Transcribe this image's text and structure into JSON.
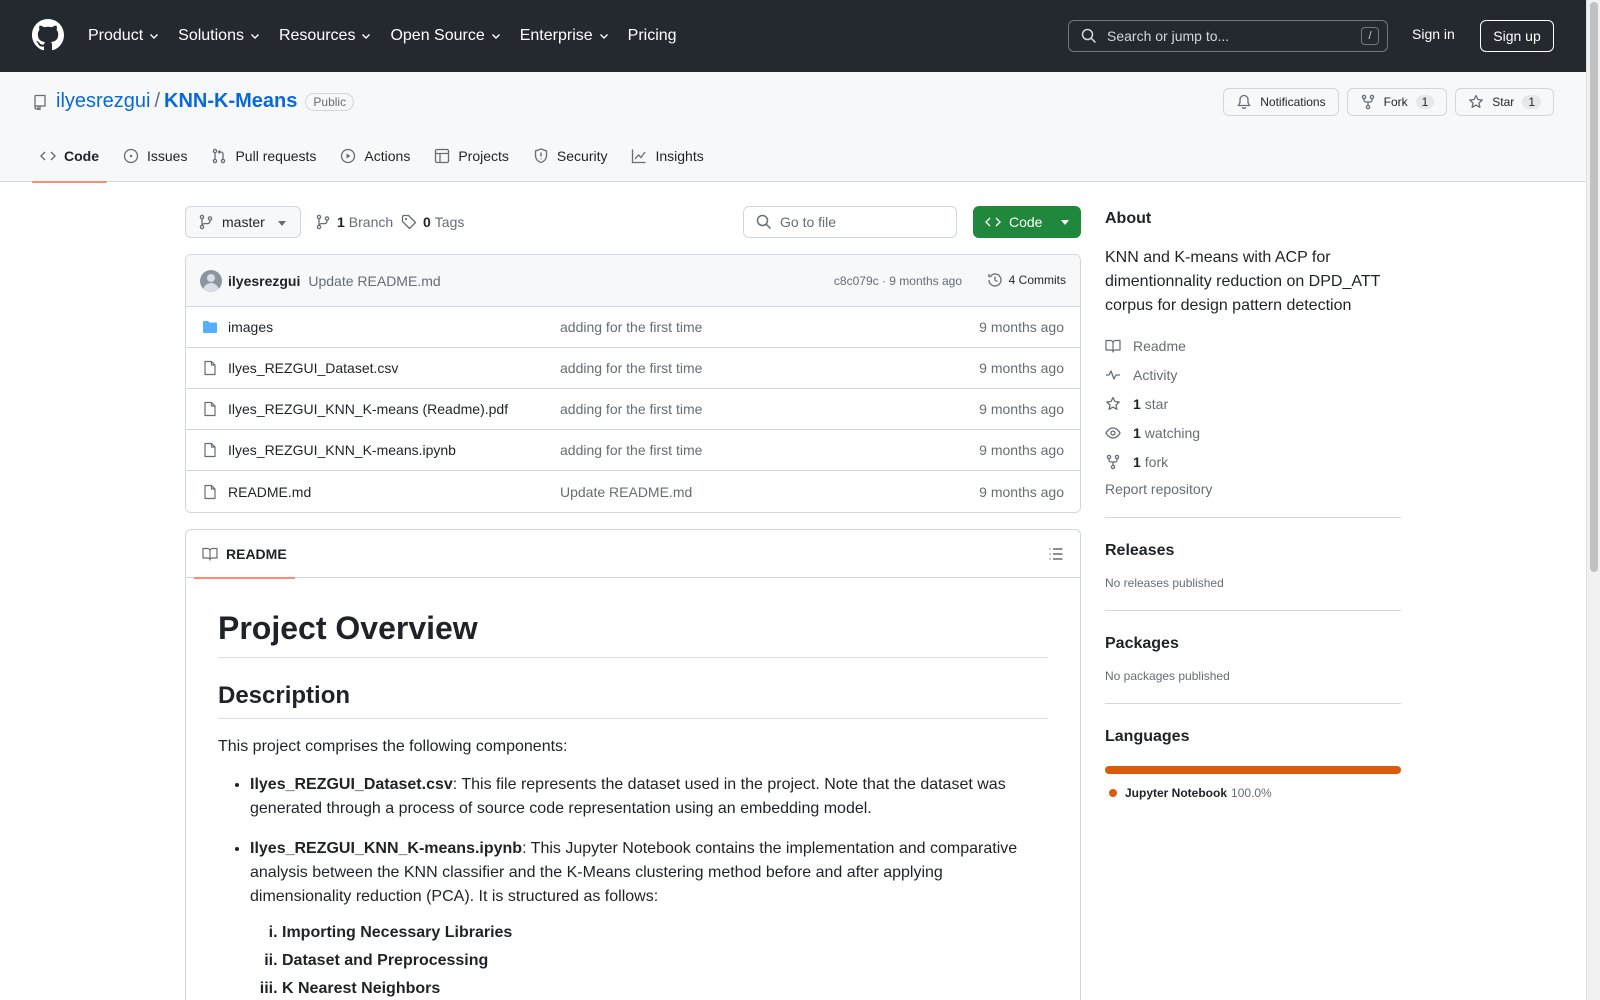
{
  "header": {
    "nav": [
      {
        "label": "Product",
        "dropdown": true
      },
      {
        "label": "Solutions",
        "dropdown": true
      },
      {
        "label": "Resources",
        "dropdown": true
      },
      {
        "label": "Open Source",
        "dropdown": true
      },
      {
        "label": "Enterprise",
        "dropdown": true
      },
      {
        "label": "Pricing",
        "dropdown": false
      }
    ],
    "search_placeholder": "Search or jump to...",
    "search_shortcut": "/",
    "sign_in": "Sign in",
    "sign_up": "Sign up"
  },
  "repo": {
    "owner": "ilyesrezgui",
    "separator": "/",
    "name": "KNN-K-Means",
    "visibility": "Public",
    "actions": {
      "notifications": "Notifications",
      "fork_label": "Fork",
      "fork_count": "1",
      "star_label": "Star",
      "star_count": "1"
    },
    "tabs": [
      {
        "label": "Code",
        "icon": "code-icon"
      },
      {
        "label": "Issues",
        "icon": "issue-icon"
      },
      {
        "label": "Pull requests",
        "icon": "pull-request-icon"
      },
      {
        "label": "Actions",
        "icon": "play-icon"
      },
      {
        "label": "Projects",
        "icon": "table-icon"
      },
      {
        "label": "Security",
        "icon": "shield-icon"
      },
      {
        "label": "Insights",
        "icon": "graph-icon"
      }
    ]
  },
  "file_nav": {
    "branch": "master",
    "branch_count": "1",
    "branch_label": "Branch",
    "tag_count": "0",
    "tag_label": "Tags",
    "goto_placeholder": "Go to file",
    "code_button": "Code"
  },
  "latest_commit": {
    "author": "ilyesrezgui",
    "message": "Update README.md",
    "meta": "c8c079c · 9 months ago",
    "commits_label": "4 Commits"
  },
  "files": [
    {
      "name": "images",
      "type": "folder",
      "message": "adding for the first time",
      "time": "9 months ago"
    },
    {
      "name": "Ilyes_REZGUI_Dataset.csv",
      "type": "file",
      "message": "adding for the first time",
      "time": "9 months ago"
    },
    {
      "name": "Ilyes_REZGUI_KNN_K-means (Readme).pdf",
      "type": "file",
      "message": "adding for the first time",
      "time": "9 months ago"
    },
    {
      "name": "Ilyes_REZGUI_KNN_K-means.ipynb",
      "type": "file",
      "message": "adding for the first time",
      "time": "9 months ago"
    },
    {
      "name": "README.md",
      "type": "file",
      "message": "Update README.md",
      "time": "9 months ago"
    }
  ],
  "readme": {
    "tab_label": "README",
    "h1": "Project Overview",
    "h2": "Description",
    "intro": "This project comprises the following components:",
    "items": [
      {
        "bold": "Ilyes_REZGUI_Dataset.csv",
        "text": ": This file represents the dataset used in the project. Note that the dataset was generated through a process of source code representation using an embedding model."
      },
      {
        "bold": "Ilyes_REZGUI_KNN_K-means.ipynb",
        "text": ": This Jupyter Notebook contains the implementation and comparative analysis between the KNN classifier and the K-Means clustering method before and after applying dimensionality reduction (PCA). It is structured as follows:"
      }
    ],
    "sub_items": [
      "Importing Necessary Libraries",
      "Dataset and Preprocessing",
      "K Nearest Neighbors"
    ]
  },
  "sidebar": {
    "about_title": "About",
    "description": "KNN and K-means with ACP for dimentionnality reduction on DPD_ATT corpus for design pattern detection",
    "readme_link": "Readme",
    "activity_link": "Activity",
    "stars_count": "1",
    "stars_label": "star",
    "watching_count": "1",
    "watching_label": "watching",
    "forks_count": "1",
    "forks_label": "fork",
    "report": "Report repository",
    "releases_title": "Releases",
    "releases_text": "No releases published",
    "packages_title": "Packages",
    "packages_text": "No packages published",
    "languages_title": "Languages",
    "languages": [
      {
        "name": "Jupyter Notebook",
        "percent": "100.0%",
        "fraction": 1.0,
        "color": "#da5b0b"
      }
    ]
  },
  "colors": {
    "header_bg": "#24292f",
    "link": "#0969da",
    "code_button": "#1f883d",
    "active_tab_underline": "#fd8c73"
  }
}
